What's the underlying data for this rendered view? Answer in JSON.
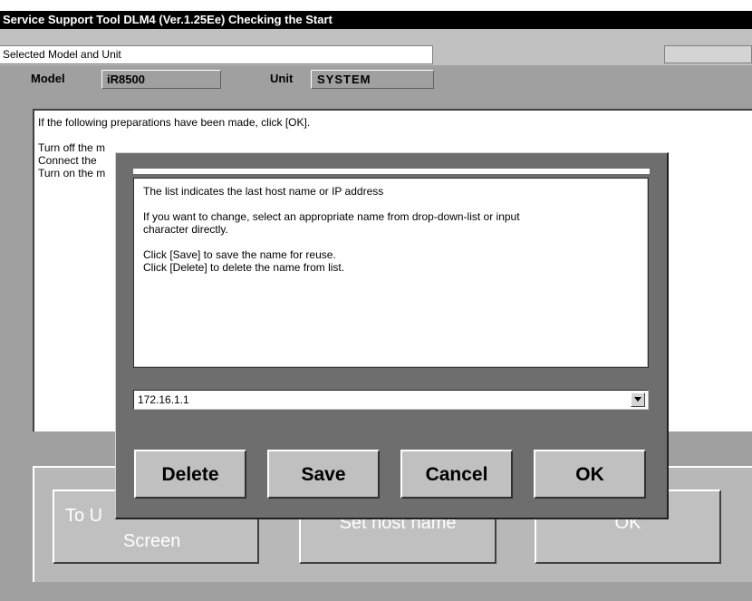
{
  "window": {
    "title": "Service Support Tool DLM4 (Ver.1.25Ee) Checking the Start",
    "selected_label": "Selected Model and Unit",
    "model_label": "Model",
    "model_value": "iR8500",
    "unit_label": "Unit",
    "unit_value": "SYSTEM"
  },
  "instructions": {
    "line1": "If the following preparations have been made, click [OK].",
    "line2": "Turn off the m",
    "line3": "Connect the",
    "line4": "Turn on the m"
  },
  "bottom_buttons": {
    "to_top_line1": "To U",
    "to_top_line2": "Screen",
    "set_host": "Set host name",
    "ok": "OK"
  },
  "dialog": {
    "info_line1": "The list indicates the last host name or IP address",
    "info_line2": "If you want to change, select an appropriate name from drop-down-list or input",
    "info_line3": "character directly.",
    "info_line4": "Click [Save] to save the name for reuse.",
    "info_line5": "Click [Delete] to delete the name from list.",
    "host_value": "172.16.1.1",
    "buttons": {
      "delete": "Delete",
      "save": "Save",
      "cancel": "Cancel",
      "ok": "OK"
    }
  },
  "icons": {
    "combo_arrow": "chevron-down-icon"
  }
}
